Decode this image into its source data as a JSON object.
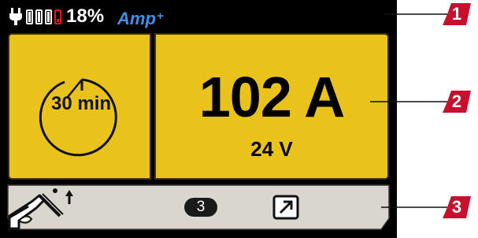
{
  "status_bar": {
    "battery_percent": "18%",
    "battery_level": 0.18,
    "mode_label": "Amp",
    "mode_suffix": "+",
    "icons": [
      "plug-icon",
      "battery-cell-icon",
      "battery-cell-icon",
      "battery-cell-icon",
      "battery-cell-low-icon"
    ]
  },
  "timer_panel": {
    "value": "30 min",
    "icon": "timer-dial-icon"
  },
  "output_panel": {
    "current": "102 A",
    "voltage": "24 V"
  },
  "bottom_bar": {
    "torch_icon": "welding-torch-icon",
    "trigger_icon": "arrow-up-icon",
    "program_number": "3",
    "expand_icon": "expand-arrow-icon"
  },
  "callouts": [
    "1",
    "2",
    "3"
  ],
  "colors": {
    "screen_background": "#000000",
    "panel_yellow": "#eac21c",
    "battery_low": "#e8131a",
    "mode_blue": "#3e8fe8",
    "bottom_bar_gray": "#d8d6cf",
    "callout_red": "#c8102e"
  }
}
